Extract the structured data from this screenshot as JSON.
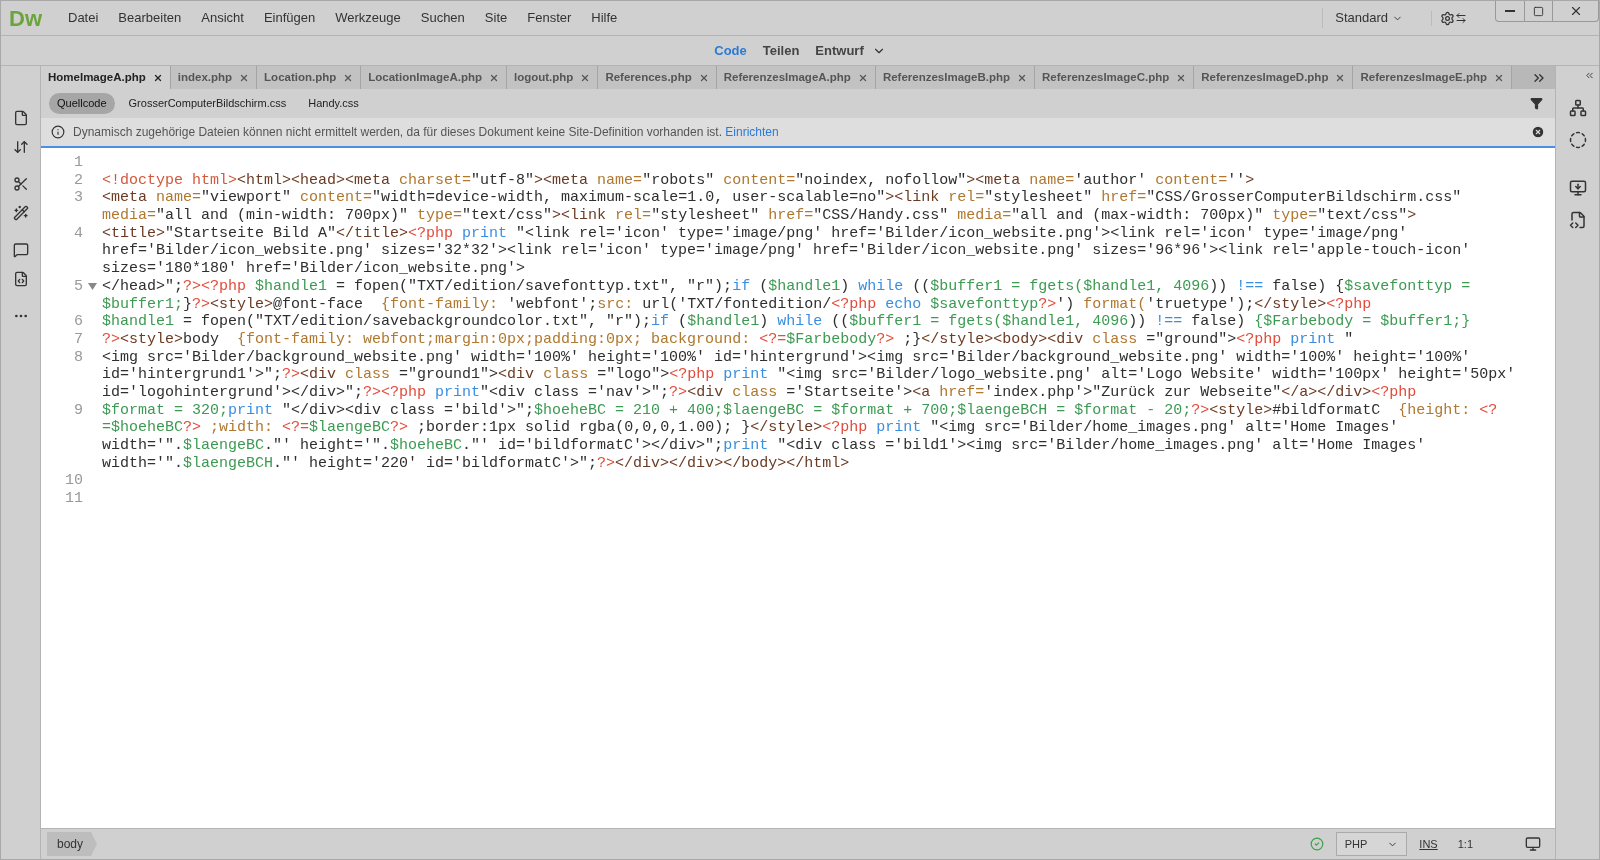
{
  "app": {
    "logo": "Dw",
    "menu": [
      "Datei",
      "Bearbeiten",
      "Ansicht",
      "Einfügen",
      "Werkzeuge",
      "Suchen",
      "Site",
      "Fenster",
      "Hilfe"
    ],
    "workspace": "Standard"
  },
  "view_switcher": [
    {
      "label": "Code",
      "selected": true
    },
    {
      "label": "Teilen",
      "selected": false
    },
    {
      "label": "Entwurf",
      "selected": false
    }
  ],
  "document_tabs": [
    {
      "label": "HomeImageA.php",
      "selected": true
    },
    {
      "label": "index.php",
      "selected": false
    },
    {
      "label": "Location.php",
      "selected": false
    },
    {
      "label": "LocationImageA.php",
      "selected": false
    },
    {
      "label": "logout.php",
      "selected": false
    },
    {
      "label": "References.php",
      "selected": false
    },
    {
      "label": "ReferenzesImageA.php",
      "selected": false
    },
    {
      "label": "ReferenzesImageB.php",
      "selected": false
    },
    {
      "label": "ReferenzesImageC.php",
      "selected": false
    },
    {
      "label": "ReferenzesImageD.php",
      "selected": false
    },
    {
      "label": "ReferenzesImageE.php",
      "selected": false
    }
  ],
  "related_files": [
    {
      "label": "Quellcode",
      "selected": true
    },
    {
      "label": "GrosserComputerBildschirm.css",
      "selected": false
    },
    {
      "label": "Handy.css",
      "selected": false
    }
  ],
  "info_bar": {
    "message": "Dynamisch zugehörige Dateien können nicht ermittelt werden, da für dieses Dokument keine Site-Definition vorhanden ist.",
    "link": "Einrichten"
  },
  "code": {
    "lines": [
      {
        "number": "1",
        "fold_marker": false
      },
      {
        "number": "2",
        "fold_marker": false,
        "rows": [
          {
            "segments": [
              {
                "kind": "doctype",
                "text": "<!doctype html>"
              },
              {
                "kind": "tag",
                "text": "<html><head><meta "
              },
              {
                "kind": "attr",
                "text": "charset="
              },
              {
                "kind": "text",
                "text": "\"utf-8\""
              },
              {
                "kind": "tag",
                "text": "><meta "
              },
              {
                "kind": "attr",
                "text": "name="
              },
              {
                "kind": "text",
                "text": "\"robots\" "
              },
              {
                "kind": "attr",
                "text": "content="
              },
              {
                "kind": "text",
                "text": "\"noindex, nofollow\""
              },
              {
                "kind": "tag",
                "text": "><meta "
              },
              {
                "kind": "attr",
                "text": "name="
              },
              {
                "kind": "text",
                "text": "'author' "
              },
              {
                "kind": "attr",
                "text": "content="
              },
              {
                "kind": "text",
                "text": "''"
              },
              {
                "kind": "tag",
                "text": ">"
              }
            ]
          }
        ]
      },
      {
        "number": "3",
        "fold_marker": false,
        "rows": [
          {
            "segments": [
              {
                "kind": "tag",
                "text": "<meta "
              },
              {
                "kind": "attr",
                "text": "name="
              },
              {
                "kind": "text",
                "text": "\"viewport\" "
              },
              {
                "kind": "attr",
                "text": "content="
              },
              {
                "kind": "text",
                "text": "\"width=device-width, maximum-scale=1.0, user-scalable=no\""
              },
              {
                "kind": "tag",
                "text": "><link "
              },
              {
                "kind": "attr",
                "text": "rel="
              },
              {
                "kind": "text",
                "text": "\"stylesheet\" "
              },
              {
                "kind": "attr",
                "text": "href="
              },
              {
                "kind": "text",
                "text": "\"CSS/GrosserComputerBildschirm.css\""
              }
            ]
          },
          {
            "segments": [
              {
                "kind": "attr",
                "text": "media="
              },
              {
                "kind": "text",
                "text": "\"all and (min-width: 700px)\" "
              },
              {
                "kind": "attr",
                "text": "type="
              },
              {
                "kind": "text",
                "text": "\"text/css\""
              },
              {
                "kind": "tag",
                "text": "><link "
              },
              {
                "kind": "attr",
                "text": "rel="
              },
              {
                "kind": "text",
                "text": "\"stylesheet\" "
              },
              {
                "kind": "attr",
                "text": "href="
              },
              {
                "kind": "text",
                "text": "\"CSS/Handy.css\" "
              },
              {
                "kind": "attr",
                "text": "media="
              },
              {
                "kind": "text",
                "text": "\"all and (max-width: 700px)\" "
              },
              {
                "kind": "attr",
                "text": "type="
              },
              {
                "kind": "text",
                "text": "\"text/css\""
              },
              {
                "kind": "tag",
                "text": ">"
              }
            ]
          }
        ]
      },
      {
        "number": "4",
        "fold_marker": false,
        "rows": [
          {
            "segments": [
              {
                "kind": "tag",
                "text": "<title>"
              },
              {
                "kind": "text",
                "text": "\"Startseite Bild A\""
              },
              {
                "kind": "tag",
                "text": "</title>"
              },
              {
                "kind": "php",
                "text": "<?php "
              },
              {
                "kind": "keyword",
                "text": "print "
              },
              {
                "kind": "text",
                "text": "\"<link rel='icon' type='image/png' href='Bilder/icon_website.png'><link rel='icon' type='image/png'"
              }
            ]
          },
          {
            "segments": [
              {
                "kind": "text",
                "text": "href='Bilder/icon_website.png' sizes='32*32'><link rel='icon' type='image/png' href='Bilder/icon_website.png' sizes='96*96'><link rel='apple-touch-icon'"
              }
            ]
          },
          {
            "segments": [
              {
                "kind": "text",
                "text": "sizes='180*180' href='Bilder/icon_website.png'>"
              }
            ]
          }
        ]
      },
      {
        "number": "5",
        "fold_marker": true,
        "rows": [
          {
            "segments": [
              {
                "kind": "text",
                "text": "</head>\";"
              },
              {
                "kind": "php",
                "text": "?><?php "
              },
              {
                "kind": "var",
                "text": "$handle1"
              },
              {
                "kind": "text",
                "text": " = fopen(\"TXT/edition/savefonttyp.txt\", \"r\");"
              },
              {
                "kind": "keyword",
                "text": "if"
              },
              {
                "kind": "text",
                "text": " ("
              },
              {
                "kind": "var",
                "text": "$handle1"
              },
              {
                "kind": "text",
                "text": ") "
              },
              {
                "kind": "keyword",
                "text": "while"
              },
              {
                "kind": "text",
                "text": " (("
              },
              {
                "kind": "var",
                "text": "$buffer1 = fgets($handle1, 4096"
              },
              {
                "kind": "text",
                "text": ")) "
              },
              {
                "kind": "keyword",
                "text": "!=="
              },
              {
                "kind": "text",
                "text": " false) {"
              },
              {
                "kind": "var",
                "text": "$savefonttyp ="
              }
            ]
          },
          {
            "segments": [
              {
                "kind": "var",
                "text": "$buffer1;"
              },
              {
                "kind": "text",
                "text": "}"
              },
              {
                "kind": "php",
                "text": "?>"
              },
              {
                "kind": "tag",
                "text": "<style>"
              },
              {
                "kind": "text",
                "text": "@font-face  "
              },
              {
                "kind": "attr",
                "text": "{font-family: "
              },
              {
                "kind": "text",
                "text": "'webfont';"
              },
              {
                "kind": "attr",
                "text": "src: "
              },
              {
                "kind": "text",
                "text": "url('TXT/fontedition/"
              },
              {
                "kind": "php",
                "text": "<?php "
              },
              {
                "kind": "keyword",
                "text": "echo "
              },
              {
                "kind": "var",
                "text": "$savefonttyp"
              },
              {
                "kind": "php",
                "text": "?>"
              },
              {
                "kind": "text",
                "text": "') "
              },
              {
                "kind": "attr",
                "text": "format("
              },
              {
                "kind": "text",
                "text": "'truetype');"
              },
              {
                "kind": "tag",
                "text": "</style>"
              },
              {
                "kind": "php",
                "text": "<?php"
              }
            ]
          }
        ]
      },
      {
        "number": "6",
        "fold_marker": false,
        "rows": [
          {
            "segments": [
              {
                "kind": "var",
                "text": "$handle1"
              },
              {
                "kind": "text",
                "text": " = fopen(\"TXT/edition/savebackgroundcolor.txt\", \"r\");"
              },
              {
                "kind": "keyword",
                "text": "if"
              },
              {
                "kind": "text",
                "text": " ("
              },
              {
                "kind": "var",
                "text": "$handle1"
              },
              {
                "kind": "text",
                "text": ") "
              },
              {
                "kind": "keyword",
                "text": "while"
              },
              {
                "kind": "text",
                "text": " (("
              },
              {
                "kind": "var",
                "text": "$buffer1 = fgets($handle1, 4096"
              },
              {
                "kind": "text",
                "text": ")) "
              },
              {
                "kind": "keyword",
                "text": "!=="
              },
              {
                "kind": "text",
                "text": " false) "
              },
              {
                "kind": "var",
                "text": "{$Farbebody = $buffer1;}"
              }
            ]
          }
        ]
      },
      {
        "number": "7",
        "fold_marker": false,
        "rows": [
          {
            "segments": [
              {
                "kind": "php",
                "text": "?>"
              },
              {
                "kind": "tag",
                "text": "<style>"
              },
              {
                "kind": "text",
                "text": "body  "
              },
              {
                "kind": "attr",
                "text": "{font-family: webfont;margin:0px;padding:0px; background: "
              },
              {
                "kind": "php",
                "text": "<?="
              },
              {
                "kind": "var",
                "text": "$Farbebody"
              },
              {
                "kind": "php",
                "text": "?>"
              },
              {
                "kind": "text",
                "text": " ;}"
              },
              {
                "kind": "tag",
                "text": "</style><body><div "
              },
              {
                "kind": "attr",
                "text": "class "
              },
              {
                "kind": "text",
                "text": "=\"ground\">"
              },
              {
                "kind": "php",
                "text": "<?php "
              },
              {
                "kind": "keyword",
                "text": "print "
              },
              {
                "kind": "text",
                "text": "\""
              }
            ]
          }
        ]
      },
      {
        "number": "8",
        "fold_marker": false,
        "rows": [
          {
            "segments": [
              {
                "kind": "text",
                "text": "<img src='Bilder/background_website.png' width='100%' height='100%' id='hintergrund'><img src='Bilder/background_website.png' width='100%' height='100%'"
              }
            ]
          },
          {
            "segments": [
              {
                "kind": "text",
                "text": "id='hintergrund1'>\";"
              },
              {
                "kind": "php",
                "text": "?>"
              },
              {
                "kind": "tag",
                "text": "<div "
              },
              {
                "kind": "attr",
                "text": "class "
              },
              {
                "kind": "text",
                "text": "=\"ground1\">"
              },
              {
                "kind": "tag",
                "text": "<div "
              },
              {
                "kind": "attr",
                "text": "class "
              },
              {
                "kind": "text",
                "text": "=\"logo\">"
              },
              {
                "kind": "php",
                "text": "<?php "
              },
              {
                "kind": "keyword",
                "text": "print "
              },
              {
                "kind": "text",
                "text": "\"<img src='Bilder/logo_website.png' alt='Logo Website' width='100px' height='50px'"
              }
            ]
          },
          {
            "segments": [
              {
                "kind": "text",
                "text": "id='logohintergrund'></div>\";"
              },
              {
                "kind": "php",
                "text": "?><?php "
              },
              {
                "kind": "keyword",
                "text": "print"
              },
              {
                "kind": "text",
                "text": "\"<div class ='nav'>\";"
              },
              {
                "kind": "php",
                "text": "?>"
              },
              {
                "kind": "tag",
                "text": "<div "
              },
              {
                "kind": "attr",
                "text": "class "
              },
              {
                "kind": "text",
                "text": "='Startseite'>"
              },
              {
                "kind": "tag",
                "text": "<a "
              },
              {
                "kind": "attr",
                "text": "href="
              },
              {
                "kind": "text",
                "text": "'index.php'>\"Zurück zur Webseite\""
              },
              {
                "kind": "tag",
                "text": "</a></div>"
              },
              {
                "kind": "php",
                "text": "<?php"
              }
            ]
          }
        ]
      },
      {
        "number": "9",
        "fold_marker": false,
        "rows": [
          {
            "segments": [
              {
                "kind": "var",
                "text": "$format = 320;"
              },
              {
                "kind": "keyword",
                "text": "print "
              },
              {
                "kind": "text",
                "text": "\"</div><div class ='bild'>\";"
              },
              {
                "kind": "var",
                "text": "$hoeheBC = 210 + 400;$laengeBC = $format + 700;$laengeBCH = $format - 20;"
              },
              {
                "kind": "php",
                "text": "?>"
              },
              {
                "kind": "tag",
                "text": "<style>"
              },
              {
                "kind": "text",
                "text": "#bildformatC  "
              },
              {
                "kind": "attr",
                "text": "{height: "
              },
              {
                "kind": "php",
                "text": "<?"
              }
            ]
          },
          {
            "segments": [
              {
                "kind": "var",
                "text": "=$hoeheBC"
              },
              {
                "kind": "php",
                "text": "?>"
              },
              {
                "kind": "attr",
                "text": " ;width: "
              },
              {
                "kind": "php",
                "text": "<?="
              },
              {
                "kind": "var",
                "text": "$laengeBC"
              },
              {
                "kind": "php",
                "text": "?>"
              },
              {
                "kind": "text",
                "text": " ;border:1px solid rgba(0,0,0,1.00); }"
              },
              {
                "kind": "tag",
                "text": "</style>"
              },
              {
                "kind": "php",
                "text": "<?php "
              },
              {
                "kind": "keyword",
                "text": "print "
              },
              {
                "kind": "text",
                "text": "\"<img src='Bilder/home_images.png' alt='Home Images'"
              }
            ]
          },
          {
            "segments": [
              {
                "kind": "text",
                "text": "width='\"."
              },
              {
                "kind": "var",
                "text": "$laengeBC"
              },
              {
                "kind": "text",
                "text": ".\"' height='\"."
              },
              {
                "kind": "var",
                "text": "$hoeheBC"
              },
              {
                "kind": "text",
                "text": ".\"' id='bildformatC'></div>\";"
              },
              {
                "kind": "keyword",
                "text": "print "
              },
              {
                "kind": "text",
                "text": "\"<div class ='bild1'><img src='Bilder/home_images.png' alt='Home Images'"
              }
            ]
          },
          {
            "segments": [
              {
                "kind": "text",
                "text": "width='\"."
              },
              {
                "kind": "var",
                "text": "$laengeBCH"
              },
              {
                "kind": "text",
                "text": ".\"' height='220' id='bildformatC'>\";"
              },
              {
                "kind": "php",
                "text": "?>"
              },
              {
                "kind": "tag",
                "text": "</div></div></body></html>"
              }
            ]
          }
        ]
      },
      {
        "number": "10",
        "fold_marker": false
      },
      {
        "number": "11",
        "fold_marker": false
      }
    ]
  },
  "status_bar": {
    "tag": "body",
    "language": "PHP",
    "mode": "INS",
    "position": "1:1"
  }
}
